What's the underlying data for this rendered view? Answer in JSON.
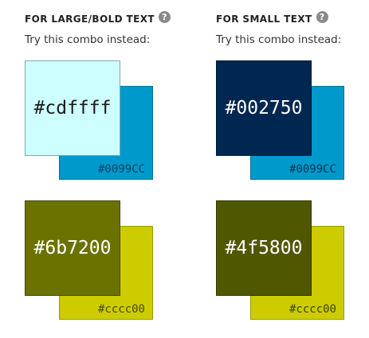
{
  "left_column": {
    "heading": "FOR LARGE/BOLD TEXT",
    "help_icon": "?",
    "subtitle": "Try this combo instead:",
    "combos": [
      {
        "foreground": "#cdffff",
        "background": "#0099CC",
        "fg_text_color": "#1a1a1a",
        "bg_text_color": "#004466"
      },
      {
        "foreground": "#6b7200",
        "background": "#cccc00",
        "fg_text_color": "#ffffff",
        "bg_text_color": "#4a4a00"
      }
    ]
  },
  "right_column": {
    "heading": "FOR SMALL TEXT",
    "help_icon": "?",
    "subtitle": "Try this combo instead:",
    "combos": [
      {
        "foreground": "#002750",
        "background": "#0099CC",
        "fg_text_color": "#ffffff",
        "bg_text_color": "#003355"
      },
      {
        "foreground": "#4f5800",
        "background": "#cccc00",
        "fg_text_color": "#ffffff",
        "bg_text_color": "#3f4400"
      }
    ]
  }
}
